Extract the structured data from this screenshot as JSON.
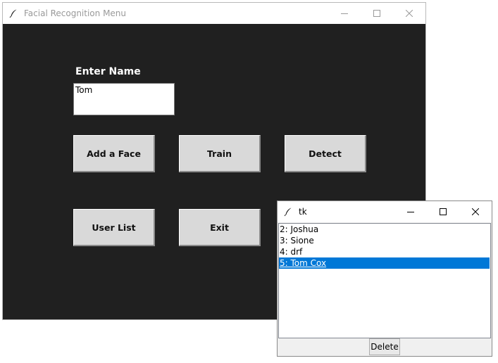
{
  "main_window": {
    "title": "Facial Recognition Menu",
    "enter_label": "Enter Name",
    "name_value": "Tom",
    "buttons": {
      "add_face": "Add a Face",
      "train": "Train",
      "detect": "Detect",
      "user_list": "User List",
      "exit": "Exit"
    },
    "background_color": "#202020"
  },
  "list_window": {
    "title": "tk",
    "items": [
      "2: Joshua",
      "3: Sione",
      "4: drf",
      "5: Tom Cox"
    ],
    "selected_index": 3,
    "delete_label": "Delete",
    "selection_color": "#0078d7"
  },
  "icons": {
    "app": "feather-icon",
    "minimize": "minimize-icon",
    "maximize": "maximize-icon",
    "close": "close-icon"
  }
}
